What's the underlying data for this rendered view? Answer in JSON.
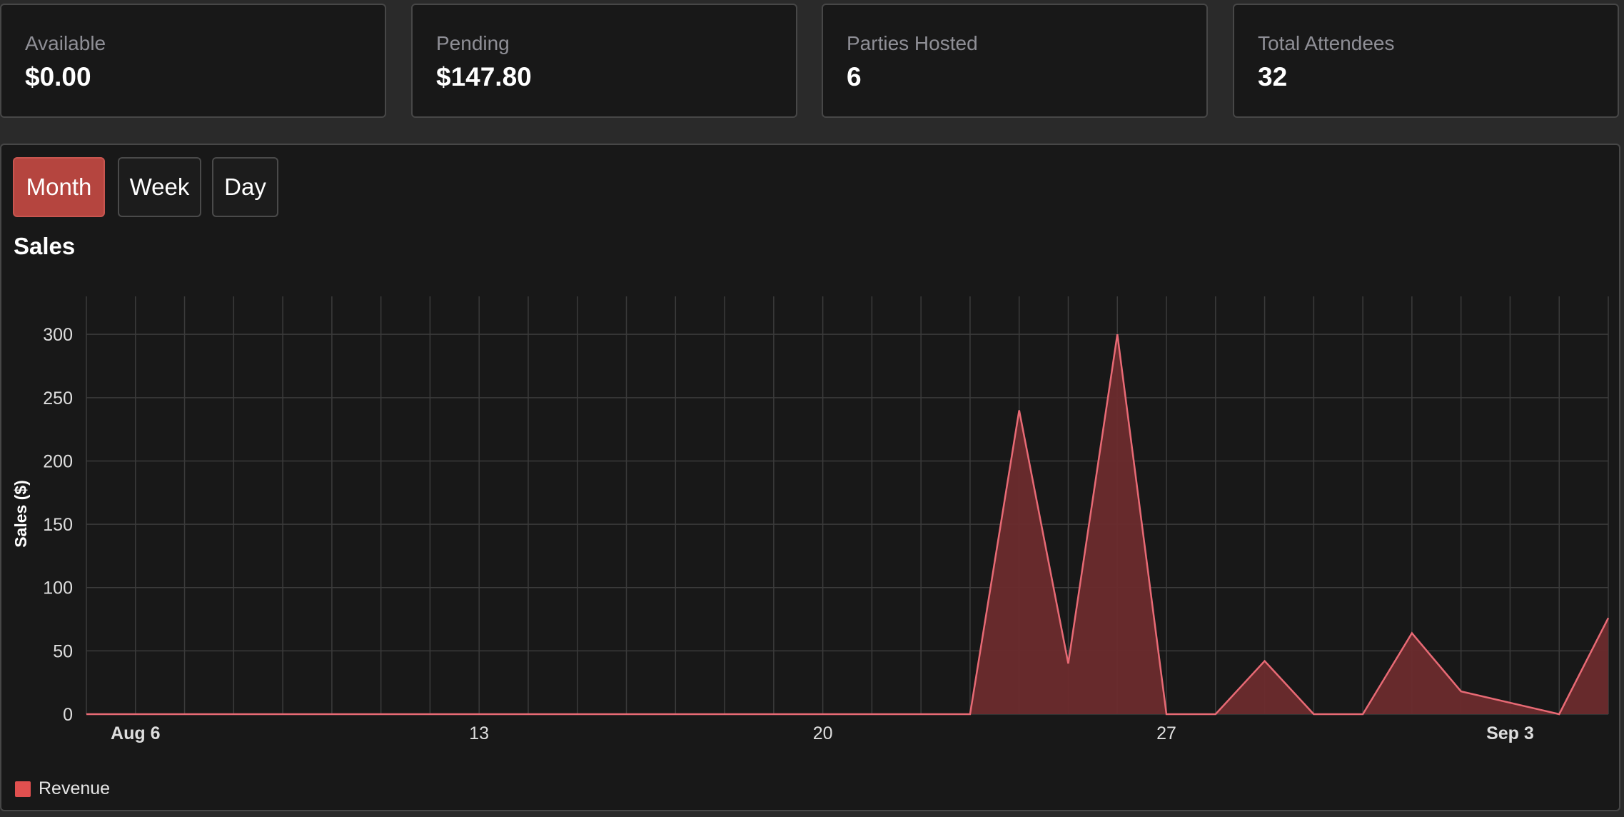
{
  "stats": [
    {
      "label": "Available",
      "value": "$0.00"
    },
    {
      "label": "Pending",
      "value": "$147.80"
    },
    {
      "label": "Parties Hosted",
      "value": "6"
    },
    {
      "label": "Total Attendees",
      "value": "32"
    }
  ],
  "tabs": [
    {
      "label": "Month",
      "active": true
    },
    {
      "label": "Week",
      "active": false
    },
    {
      "label": "Day",
      "active": false
    }
  ],
  "colors": {
    "background": "#181818",
    "accent": "#b5453f",
    "series_line": "#e86a75",
    "series_fill": "#6b2b2d",
    "grid": "#3b3b3b"
  },
  "chart_data": {
    "type": "area",
    "title": "Sales",
    "ylabel": "Sales ($)",
    "xlabel": "",
    "ylim": [
      0,
      330
    ],
    "xlim": [
      "Aug 5",
      "Sep 5"
    ],
    "yticks": [
      0,
      50,
      100,
      150,
      200,
      250,
      300
    ],
    "xticks": [
      {
        "date": "Aug 6",
        "label": "Aug 6",
        "bold": true
      },
      {
        "date": "Aug 13",
        "label": "13",
        "bold": false
      },
      {
        "date": "Aug 20",
        "label": "20",
        "bold": false
      },
      {
        "date": "Aug 27",
        "label": "27",
        "bold": false
      },
      {
        "date": "Sep 3",
        "label": "Sep 3",
        "bold": true
      }
    ],
    "grid": true,
    "legend": "bottom-left",
    "series": [
      {
        "name": "Revenue",
        "points": [
          {
            "x": "Aug 5",
            "y": 0
          },
          {
            "x": "Aug 23",
            "y": 0
          },
          {
            "x": "Aug 24",
            "y": 240
          },
          {
            "x": "Aug 25",
            "y": 40
          },
          {
            "x": "Aug 26",
            "y": 300
          },
          {
            "x": "Aug 27",
            "y": 0
          },
          {
            "x": "Aug 28",
            "y": 0
          },
          {
            "x": "Aug 29",
            "y": 42
          },
          {
            "x": "Aug 30",
            "y": 0
          },
          {
            "x": "Aug 31",
            "y": 0
          },
          {
            "x": "Sep 1",
            "y": 64
          },
          {
            "x": "Sep 2",
            "y": 18
          },
          {
            "x": "Sep 4",
            "y": 0
          },
          {
            "x": "Sep 5",
            "y": 76
          }
        ]
      }
    ]
  }
}
